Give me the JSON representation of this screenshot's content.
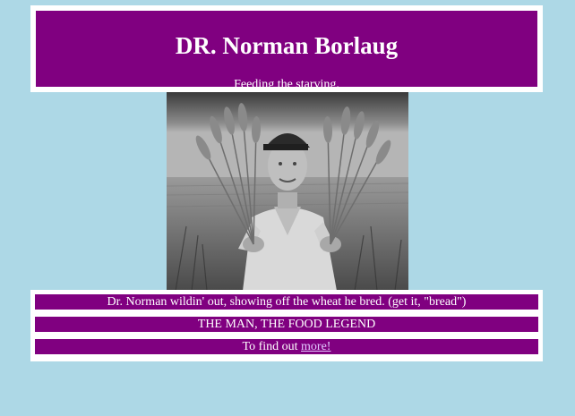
{
  "header": {
    "title": "DR. Norman Borlaug",
    "subtitle": "Feeding the starving."
  },
  "photo": {
    "icon": "borlaug-wheat-photo"
  },
  "info": {
    "caption": "Dr. Norman wildin' out, showing off the wheat he bred. (get it, \"bread\")",
    "tagline": "THE MAN, THE FOOD LEGEND",
    "more_prefix": "To find out ",
    "more_link": "more!"
  },
  "colors": {
    "background": "#add8e6",
    "panel": "#800080",
    "frame": "#ffffff",
    "link": "#e3c8ff"
  }
}
